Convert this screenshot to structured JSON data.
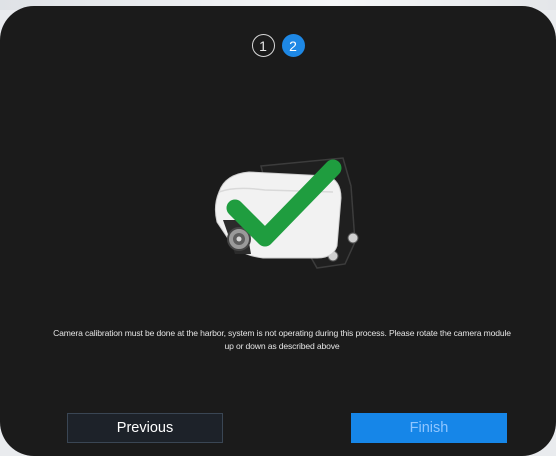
{
  "wizard": {
    "steps": [
      {
        "label": "1",
        "state": "completed"
      },
      {
        "label": "2",
        "state": "active"
      }
    ],
    "illustration": {
      "subject": "camera-module",
      "overlay_icon": "checkmark-icon",
      "colors": {
        "camera_body": "#f2f2f2",
        "bracket": "#1f1f1f",
        "check": "#1f9d3f"
      }
    },
    "message_line1": "Camera calibration must be done at the harbor, system is not operating during this process. Please rotate the camera module",
    "message_line2": "up or down as described above",
    "buttons": {
      "previous_label": "Previous",
      "finish_label": "Finish"
    }
  },
  "colors": {
    "dialog_background": "#1b1b1b",
    "accent": "#1e88e5",
    "finish_button": "#1686e8",
    "finish_text": "#8fc6ff",
    "previous_border": "#3a4654"
  }
}
